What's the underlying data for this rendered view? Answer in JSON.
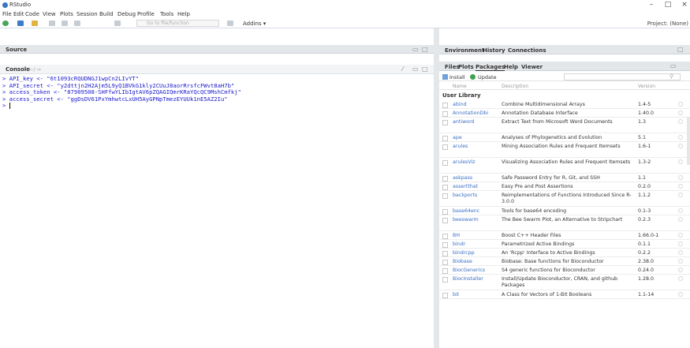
{
  "window": {
    "title": "RStudio",
    "controls": [
      "–",
      "□",
      "×"
    ]
  },
  "menu": [
    "File",
    "Edit",
    "Code",
    "View",
    "Plots",
    "Session",
    "Build",
    "Debug",
    "Profile",
    "Tools",
    "Help"
  ],
  "toolbar": {
    "goto_placeholder": "Go to file/function",
    "addins_label": "Addins ▾",
    "project_label": "Project: (None)"
  },
  "source": {
    "title": "Source"
  },
  "console": {
    "title": "Console",
    "path": "~/ ⇨",
    "lines": [
      "> API_key <- \"6t1093cRQUDNGJ1wpCn2LIvYT\"",
      "> API_secret <- \"y2dttjn2H2Ajm5L9yQ1BVkG1kly2CUuJ8aorRrsfcFWvt8aH7b\"",
      "> access_token <- \"87909508-SHFfwYLIbIgtAV6pZQAGIQmrKRaYQcQC9MshCmfkj\"",
      "> access_secret <- \"ggDsDV61PxYmhwtcLxUH5AyGPNpTmezEYUUk1nE5AZ2Iu\"",
      "> "
    ]
  },
  "right_top": {
    "tabs": [
      "Environment",
      "History",
      "Connections"
    ]
  },
  "packages": {
    "tabs": [
      "Files",
      "Plots",
      "Packages",
      "Help",
      "Viewer"
    ],
    "active_tab": "Packages",
    "install_label": "Install",
    "update_label": "Update",
    "search_placeholder": "",
    "col_name": "Name",
    "col_desc": "Description",
    "col_ver": "Version",
    "section": "User Library",
    "rows": [
      {
        "name": "abind",
        "desc": "Combine Multidimensional Arrays",
        "ver": "1.4-5"
      },
      {
        "name": "AnnotationDbi",
        "desc": "Annotation Database Interface",
        "ver": "1.40.0"
      },
      {
        "name": "antiword",
        "desc": "Extract Text from Microsoft Word Documents",
        "ver": "1.3"
      },
      {
        "name": "ape",
        "desc": "Analyses of Phylogenetics and Evolution",
        "ver": "5.1"
      },
      {
        "name": "arules",
        "desc": "Mining Association Rules and Frequent Itemsets",
        "ver": "1.6-1"
      },
      {
        "name": "arulesViz",
        "desc": "Visualizing Association Rules and Frequent Itemsets",
        "ver": "1.3-2"
      },
      {
        "name": "askpass",
        "desc": "Safe Password Entry for R, Git, and SSH",
        "ver": "1.1"
      },
      {
        "name": "assertthat",
        "desc": "Easy Pre and Post Assertions",
        "ver": "0.2.0"
      },
      {
        "name": "backports",
        "desc": "Reimplementations of Functions Introduced Since R-3.0.0",
        "ver": "1.1.2"
      },
      {
        "name": "base64enc",
        "desc": "Tools for base64 encoding",
        "ver": "0.1-3"
      },
      {
        "name": "beeswarm",
        "desc": "The Bee Swarm Plot, an Alternative to Stripchart",
        "ver": "0.2.3"
      },
      {
        "name": "BH",
        "desc": "Boost C++ Header Files",
        "ver": "1.66.0-1"
      },
      {
        "name": "bindr",
        "desc": "Parametrized Active Bindings",
        "ver": "0.1.1"
      },
      {
        "name": "bindrcpp",
        "desc": "An 'Rcpp' Interface to Active Bindings",
        "ver": "0.2.2"
      },
      {
        "name": "Biobase",
        "desc": "Biobase: Base functions for Bioconductor",
        "ver": "2.38.0"
      },
      {
        "name": "BiocGenerics",
        "desc": "S4 generic functions for Bioconductor",
        "ver": "0.24.0"
      },
      {
        "name": "BiocInstaller",
        "desc": "Install/Update Bioconductor, CRAN, and github Packages",
        "ver": "1.28.0"
      },
      {
        "name": "bit",
        "desc": "A Class for Vectors of 1-Bit Booleans",
        "ver": "1.1-14"
      }
    ]
  }
}
